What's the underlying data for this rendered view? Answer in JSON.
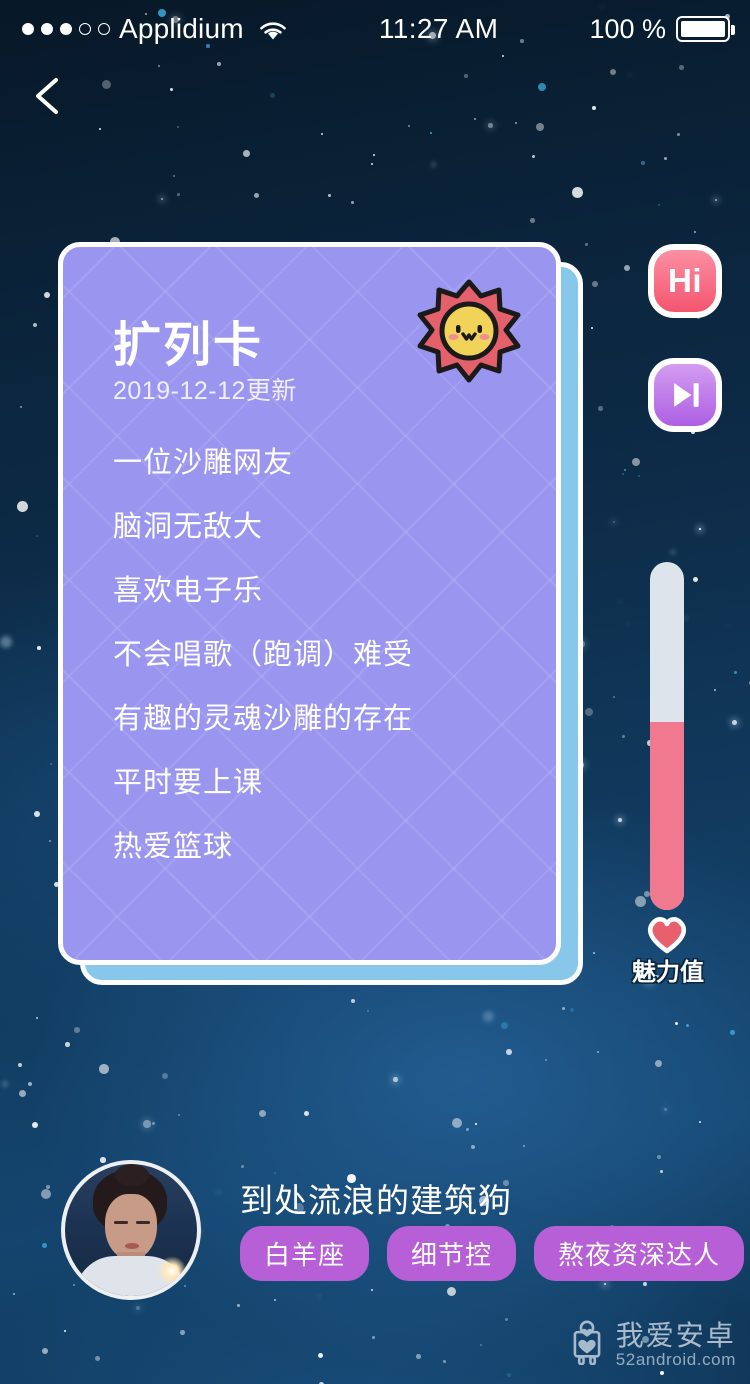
{
  "status_bar": {
    "carrier": "Applidium",
    "signal_dots_filled": 3,
    "signal_dots_total": 5,
    "wifi_icon": "wifi-icon",
    "time": "11:27 AM",
    "battery_percent": "100 %",
    "battery_icon": "battery-full-icon"
  },
  "nav": {
    "back_icon": "chevron-left-icon"
  },
  "card": {
    "title": "扩列卡",
    "date": "2019-12-12更新",
    "sticker_icon": "sun-sticker-icon",
    "lines": [
      "一位沙雕网友",
      "脑洞无敌大",
      "喜欢电子乐",
      "不会唱歌（跑调）难受",
      "有趣的灵魂沙雕的存在",
      "平时要上课",
      "热爱篮球"
    ],
    "front_color": "#9a96f0",
    "back_color": "#86c7ea"
  },
  "actions": {
    "hi_label": "Hi",
    "hi_color": "#f4556f",
    "next_icon": "skip-next-icon",
    "next_color": "#ad5fe4"
  },
  "charm_meter": {
    "label": "魅力值",
    "heart_icon": "heart-icon",
    "fill_percent": 54,
    "track_color": "#dee4ec",
    "fill_color": "#f0798f"
  },
  "profile": {
    "avatar_icon": "user-avatar-photo",
    "username": "到处流浪的建筑狗",
    "tags": [
      "白羊座",
      "细节控",
      "熬夜资深达人"
    ],
    "tag_color": "#b75fd6"
  },
  "watermark": {
    "logo_icon": "android-mascot-icon",
    "main": "我爱安卓",
    "sub": "52android.com"
  }
}
